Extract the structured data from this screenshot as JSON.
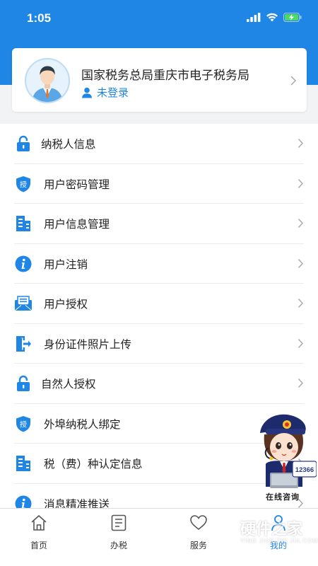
{
  "status_bar": {
    "time": "1:05"
  },
  "profile": {
    "title": "国家税务总局重庆市电子税务局",
    "login_status": "未登录"
  },
  "menu": {
    "items": [
      {
        "label": "纳税人信息",
        "icon": "lock-icon"
      },
      {
        "label": "用户密码管理",
        "icon": "shield-auth-icon"
      },
      {
        "label": "用户信息管理",
        "icon": "building-icon"
      },
      {
        "label": "用户注销",
        "icon": "info-icon"
      },
      {
        "label": "用户授权",
        "icon": "mail-icon"
      },
      {
        "label": "身份证件照片上传",
        "icon": "door-exit-icon"
      },
      {
        "label": "自然人授权",
        "icon": "lock-icon"
      },
      {
        "label": "外埠纳税人绑定",
        "icon": "shield-auth-icon"
      },
      {
        "label": "税（费）种认定信息",
        "icon": "building-icon"
      },
      {
        "label": "消息精准推送",
        "icon": "info-icon"
      }
    ]
  },
  "tabbar": {
    "tabs": [
      {
        "label": "首页",
        "icon": "home-icon"
      },
      {
        "label": "办税",
        "icon": "list-icon"
      },
      {
        "label": "服务",
        "icon": "heart-icon"
      },
      {
        "label": "我的",
        "icon": "user-icon",
        "active": true
      }
    ]
  },
  "mascot": {
    "label": "在线咨询",
    "badge": "12366"
  },
  "watermark": {
    "title": "硬件之家",
    "subtitle": "YING JIAN ZHI JIA.COM"
  },
  "colors": {
    "primary": "#1f86e6",
    "background": "#f2f3f5",
    "text": "#222222"
  }
}
